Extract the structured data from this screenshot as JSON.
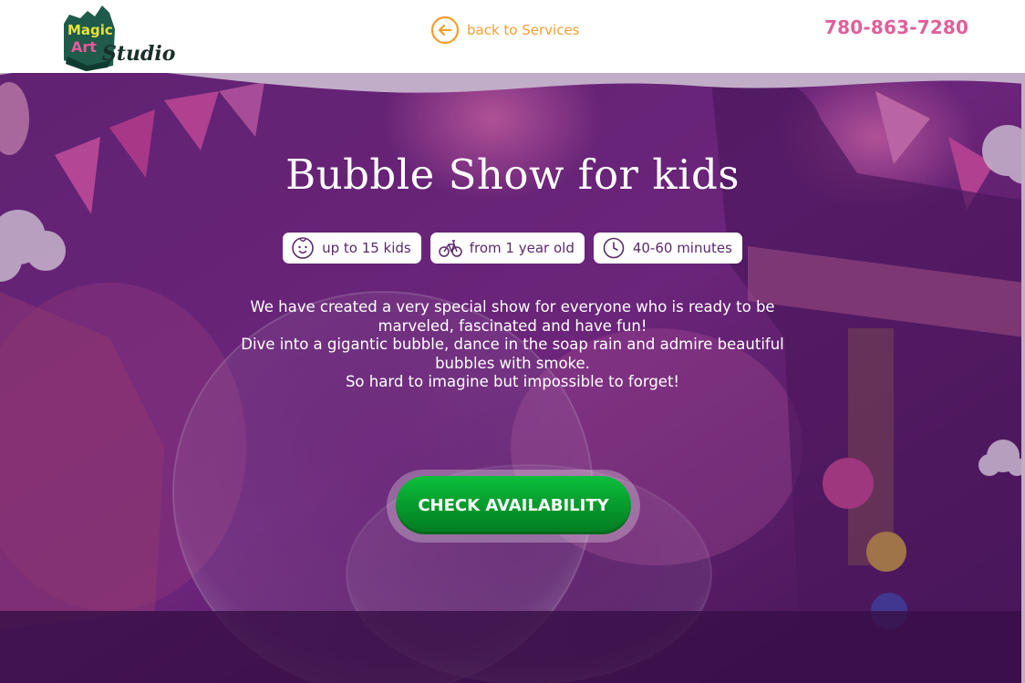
{
  "header": {
    "logo_text": [
      "Magic",
      "Art",
      "Studio"
    ],
    "back_label": "back to Services",
    "phone": "780-863-7280"
  },
  "hero": {
    "title": "Bubble Show for kids",
    "badges": [
      {
        "icon": "baby-face-icon",
        "label": "up to 15 kids"
      },
      {
        "icon": "bicycle-icon",
        "label": "from 1 year old"
      },
      {
        "icon": "clock-icon",
        "label": "40-60 minutes"
      }
    ],
    "description": [
      "We have created a very special show for everyone who is ready to be marveled, fascinated and have fun!",
      "Dive into a gigantic bubble, dance in the soap rain and admire beautiful bubbles with smoke.",
      "So hard to imagine but impossible to forget!"
    ],
    "cta_label": "CHECK AVAILABILITY"
  },
  "colors": {
    "accent_orange": "#f0a030",
    "phone_pink": "#e0609a",
    "cta_green": "#05942a",
    "badge_text": "#5a2a6a"
  }
}
